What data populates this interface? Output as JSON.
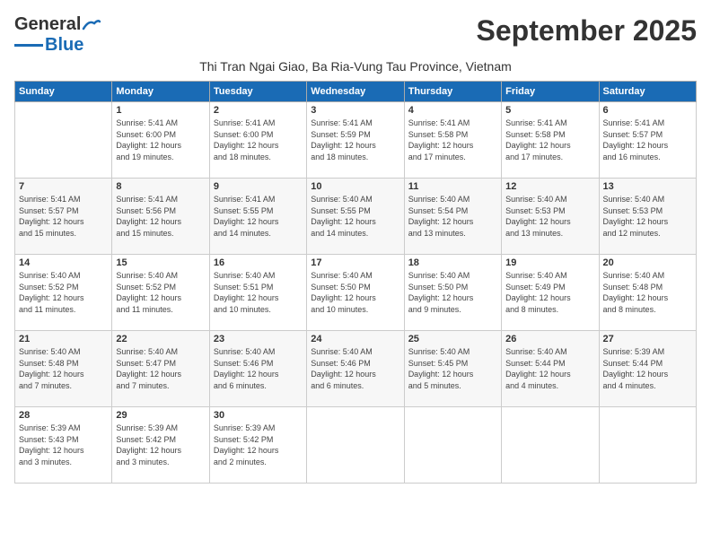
{
  "logo": {
    "general": "General",
    "blue": "Blue"
  },
  "title": "September 2025",
  "subtitle": "Thi Tran Ngai Giao, Ba Ria-Vung Tau Province, Vietnam",
  "headers": [
    "Sunday",
    "Monday",
    "Tuesday",
    "Wednesday",
    "Thursday",
    "Friday",
    "Saturday"
  ],
  "weeks": [
    [
      {
        "day": "",
        "info": ""
      },
      {
        "day": "1",
        "info": "Sunrise: 5:41 AM\nSunset: 6:00 PM\nDaylight: 12 hours\nand 19 minutes."
      },
      {
        "day": "2",
        "info": "Sunrise: 5:41 AM\nSunset: 6:00 PM\nDaylight: 12 hours\nand 18 minutes."
      },
      {
        "day": "3",
        "info": "Sunrise: 5:41 AM\nSunset: 5:59 PM\nDaylight: 12 hours\nand 18 minutes."
      },
      {
        "day": "4",
        "info": "Sunrise: 5:41 AM\nSunset: 5:58 PM\nDaylight: 12 hours\nand 17 minutes."
      },
      {
        "day": "5",
        "info": "Sunrise: 5:41 AM\nSunset: 5:58 PM\nDaylight: 12 hours\nand 17 minutes."
      },
      {
        "day": "6",
        "info": "Sunrise: 5:41 AM\nSunset: 5:57 PM\nDaylight: 12 hours\nand 16 minutes."
      }
    ],
    [
      {
        "day": "7",
        "info": "Sunrise: 5:41 AM\nSunset: 5:57 PM\nDaylight: 12 hours\nand 15 minutes."
      },
      {
        "day": "8",
        "info": "Sunrise: 5:41 AM\nSunset: 5:56 PM\nDaylight: 12 hours\nand 15 minutes."
      },
      {
        "day": "9",
        "info": "Sunrise: 5:41 AM\nSunset: 5:55 PM\nDaylight: 12 hours\nand 14 minutes."
      },
      {
        "day": "10",
        "info": "Sunrise: 5:40 AM\nSunset: 5:55 PM\nDaylight: 12 hours\nand 14 minutes."
      },
      {
        "day": "11",
        "info": "Sunrise: 5:40 AM\nSunset: 5:54 PM\nDaylight: 12 hours\nand 13 minutes."
      },
      {
        "day": "12",
        "info": "Sunrise: 5:40 AM\nSunset: 5:53 PM\nDaylight: 12 hours\nand 13 minutes."
      },
      {
        "day": "13",
        "info": "Sunrise: 5:40 AM\nSunset: 5:53 PM\nDaylight: 12 hours\nand 12 minutes."
      }
    ],
    [
      {
        "day": "14",
        "info": "Sunrise: 5:40 AM\nSunset: 5:52 PM\nDaylight: 12 hours\nand 11 minutes."
      },
      {
        "day": "15",
        "info": "Sunrise: 5:40 AM\nSunset: 5:52 PM\nDaylight: 12 hours\nand 11 minutes."
      },
      {
        "day": "16",
        "info": "Sunrise: 5:40 AM\nSunset: 5:51 PM\nDaylight: 12 hours\nand 10 minutes."
      },
      {
        "day": "17",
        "info": "Sunrise: 5:40 AM\nSunset: 5:50 PM\nDaylight: 12 hours\nand 10 minutes."
      },
      {
        "day": "18",
        "info": "Sunrise: 5:40 AM\nSunset: 5:50 PM\nDaylight: 12 hours\nand 9 minutes."
      },
      {
        "day": "19",
        "info": "Sunrise: 5:40 AM\nSunset: 5:49 PM\nDaylight: 12 hours\nand 8 minutes."
      },
      {
        "day": "20",
        "info": "Sunrise: 5:40 AM\nSunset: 5:48 PM\nDaylight: 12 hours\nand 8 minutes."
      }
    ],
    [
      {
        "day": "21",
        "info": "Sunrise: 5:40 AM\nSunset: 5:48 PM\nDaylight: 12 hours\nand 7 minutes."
      },
      {
        "day": "22",
        "info": "Sunrise: 5:40 AM\nSunset: 5:47 PM\nDaylight: 12 hours\nand 7 minutes."
      },
      {
        "day": "23",
        "info": "Sunrise: 5:40 AM\nSunset: 5:46 PM\nDaylight: 12 hours\nand 6 minutes."
      },
      {
        "day": "24",
        "info": "Sunrise: 5:40 AM\nSunset: 5:46 PM\nDaylight: 12 hours\nand 6 minutes."
      },
      {
        "day": "25",
        "info": "Sunrise: 5:40 AM\nSunset: 5:45 PM\nDaylight: 12 hours\nand 5 minutes."
      },
      {
        "day": "26",
        "info": "Sunrise: 5:40 AM\nSunset: 5:44 PM\nDaylight: 12 hours\nand 4 minutes."
      },
      {
        "day": "27",
        "info": "Sunrise: 5:39 AM\nSunset: 5:44 PM\nDaylight: 12 hours\nand 4 minutes."
      }
    ],
    [
      {
        "day": "28",
        "info": "Sunrise: 5:39 AM\nSunset: 5:43 PM\nDaylight: 12 hours\nand 3 minutes."
      },
      {
        "day": "29",
        "info": "Sunrise: 5:39 AM\nSunset: 5:42 PM\nDaylight: 12 hours\nand 3 minutes."
      },
      {
        "day": "30",
        "info": "Sunrise: 5:39 AM\nSunset: 5:42 PM\nDaylight: 12 hours\nand 2 minutes."
      },
      {
        "day": "",
        "info": ""
      },
      {
        "day": "",
        "info": ""
      },
      {
        "day": "",
        "info": ""
      },
      {
        "day": "",
        "info": ""
      }
    ]
  ]
}
